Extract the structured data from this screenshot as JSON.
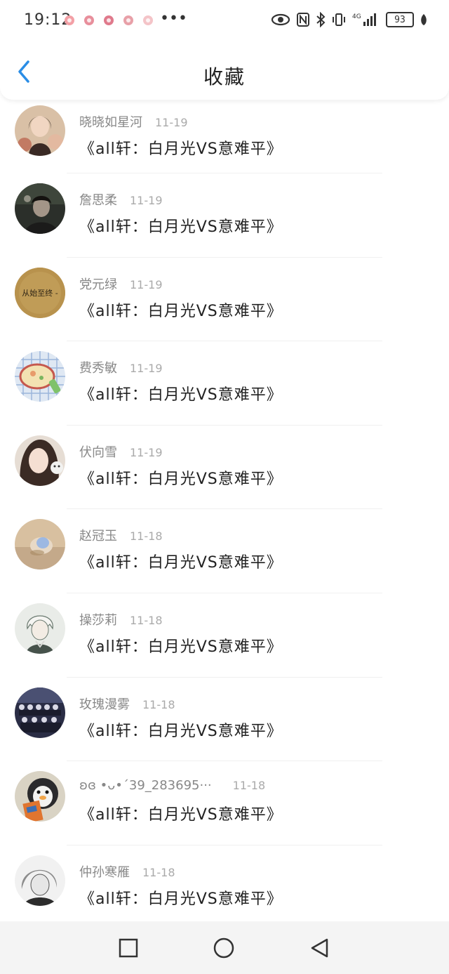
{
  "status_bar": {
    "time": "19:12",
    "more": "•••",
    "battery": "93",
    "notification_colors": [
      "#f3a0a6",
      "#e88f9c",
      "#e07a8c",
      "#e8a0a8",
      "#f4c4c8"
    ]
  },
  "header": {
    "title": "收藏"
  },
  "favorites": [
    {
      "author": "晓晓如星河",
      "date": "11-19",
      "title": "《all轩：白月光VS意难平》"
    },
    {
      "author": "詹思柔",
      "date": "11-19",
      "title": "《all轩：白月光VS意难平》"
    },
    {
      "author": "党元绿",
      "date": "11-19",
      "title": "《all轩：白月光VS意难平》"
    },
    {
      "author": "费秀敏",
      "date": "11-19",
      "title": "《all轩：白月光VS意难平》"
    },
    {
      "author": "伏向雪",
      "date": "11-19",
      "title": "《all轩：白月光VS意难平》"
    },
    {
      "author": "赵冠玉",
      "date": "11-18",
      "title": "《all轩：白月光VS意难平》"
    },
    {
      "author": "操莎莉",
      "date": "11-18",
      "title": "《all轩：白月光VS意难平》"
    },
    {
      "author": "玫瑰漫雾",
      "date": "11-18",
      "title": "《all轩：白月光VS意难平》"
    },
    {
      "author": "ʚɞ •ᴗ•´39_283695···",
      "date": "11-18",
      "title": "《all轩：白月光VS意难平》"
    },
    {
      "author": "仲孙寒雁",
      "date": "11-18",
      "title": "《all轩：白月光VS意难平》"
    }
  ],
  "avatar_3_text": "从始至终 -",
  "colors": {
    "accent": "#2a8de6",
    "primary_text": "#222222",
    "secondary_text": "#888888",
    "nav_bar_bg": "#f4f4f4"
  },
  "icons": {
    "back": "chevron-left-icon",
    "eye": "eye-icon",
    "nfc": "nfc-icon",
    "bluetooth": "bluetooth-icon",
    "vibrate": "vibrate-icon",
    "signal": "signal-icon",
    "battery": "battery-icon",
    "leaf": "leaf-icon",
    "nav_recents": "square-icon",
    "nav_home": "circle-icon",
    "nav_back": "triangle-back-icon"
  }
}
